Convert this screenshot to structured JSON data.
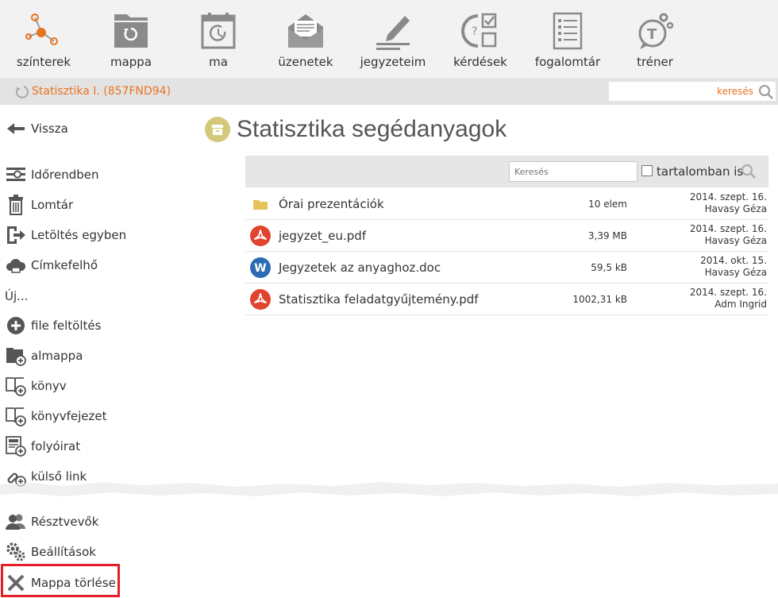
{
  "nav": [
    {
      "label": "színterek",
      "icon": "network-icon"
    },
    {
      "label": "mappa",
      "icon": "folder-icon"
    },
    {
      "label": "ma",
      "icon": "calendar-icon"
    },
    {
      "label": "üzenetek",
      "icon": "envelope-icon"
    },
    {
      "label": "jegyzeteim",
      "icon": "pencil-icon"
    },
    {
      "label": "kérdések",
      "icon": "quiz-icon"
    },
    {
      "label": "fogalomtár",
      "icon": "glossary-icon"
    },
    {
      "label": "tréner",
      "icon": "trainer-icon"
    }
  ],
  "breadcrumb": {
    "label": "Statisztika I. (857FND94)"
  },
  "search": {
    "placeholder": "keresés"
  },
  "sidebar": {
    "back": "Vissza",
    "items": [
      {
        "label": "Időrendben",
        "icon": "timeline-icon"
      },
      {
        "label": "Lomtár",
        "icon": "trash-icon"
      },
      {
        "label": "Letöltés egyben",
        "icon": "download-icon"
      },
      {
        "label": "Címkefelhő",
        "icon": "cloud-icon"
      }
    ],
    "new_heading": "Új...",
    "new_items": [
      {
        "label": "file feltöltés",
        "icon": "plus-circle-icon"
      },
      {
        "label": "almappa",
        "icon": "folder-plus-icon"
      },
      {
        "label": "könyv",
        "icon": "book-plus-icon"
      },
      {
        "label": "könyvfejezet",
        "icon": "chapter-plus-icon"
      },
      {
        "label": "folyóirat",
        "icon": "journal-plus-icon"
      },
      {
        "label": "külső link",
        "icon": "link-plus-icon"
      }
    ],
    "bottom_items": [
      {
        "label": "Résztvevők",
        "icon": "users-icon"
      },
      {
        "label": "Beállítások",
        "icon": "gears-icon"
      },
      {
        "label": "Mappa törlése",
        "icon": "delete-icon"
      }
    ]
  },
  "main": {
    "title": "Statisztika segédanyagok",
    "filter_placeholder": "Keresés",
    "content_search_label": "tartalomban is",
    "files": [
      {
        "name": "Órai prezentációk",
        "type": "folder",
        "size": "10 elem",
        "date": "2014. szept. 16.",
        "user": "Havasy Géza"
      },
      {
        "name": "jegyzet_eu.pdf",
        "type": "pdf",
        "size": "3,39 MB",
        "date": "2014. szept. 16.",
        "user": "Havasy Géza"
      },
      {
        "name": "Jegyzetek az anyaghoz.doc",
        "type": "doc",
        "size": "59,5 kB",
        "date": "2014. okt. 15.",
        "user": "Havasy Géza"
      },
      {
        "name": "Statisztika feladatgyűjtemény.pdf",
        "type": "pdf",
        "size": "1002,31 kB",
        "date": "2014. szept. 16.",
        "user": "Adm Ingrid"
      }
    ]
  },
  "colors": {
    "accent": "#e8731f",
    "highlight": "#e3202a",
    "pdf": "#e0442f",
    "doc": "#2b6cb3",
    "folder": "#e8c35a"
  }
}
